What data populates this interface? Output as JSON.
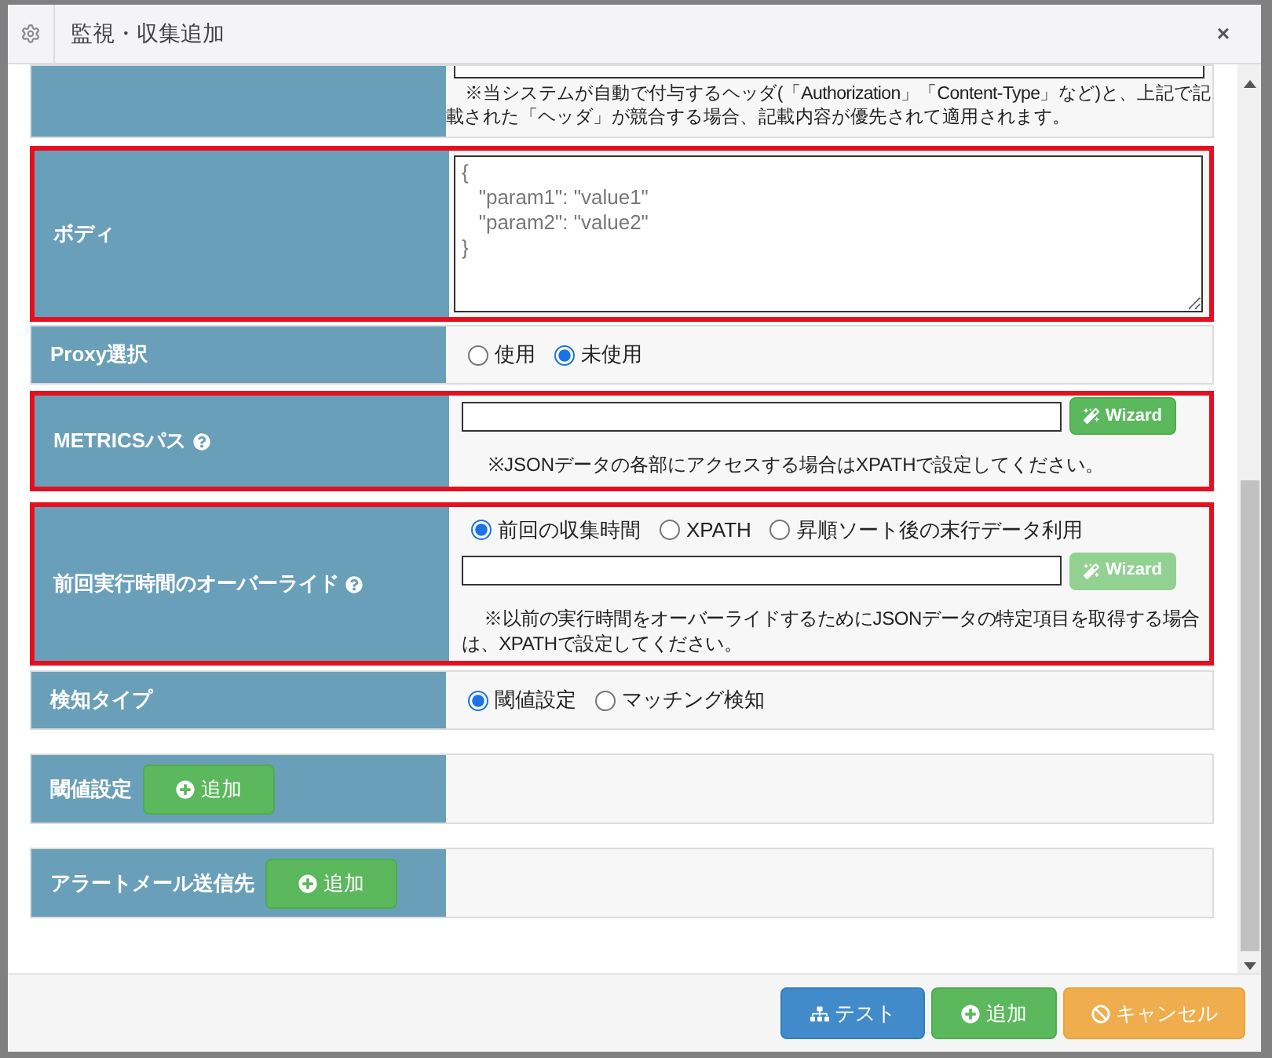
{
  "window": {
    "title": "監視・収集追加",
    "close": "×"
  },
  "rows": [
    {
      "kind": "note_tail",
      "highlighted": false,
      "note": "※当システムが自動で付与するヘッダ(「Authorization」「Content-Type」など)と、上記で記載された「ヘッダ」が競合する場合、記載内容が優先されて適用されます。"
    },
    {
      "kind": "textarea",
      "label": "ボディ",
      "highlighted": true,
      "placeholder": "{\n   \"param1\": \"value1\"\n   \"param2\": \"value2\"\n}"
    },
    {
      "kind": "radio",
      "label": "Proxy選択",
      "highlighted": false,
      "options": [
        {
          "label": "使用",
          "selected": false
        },
        {
          "label": "未使用",
          "selected": true
        }
      ]
    },
    {
      "kind": "path",
      "label": "METRICSパス",
      "help": true,
      "highlighted": true,
      "button": {
        "label": "Wizard",
        "disabled": false
      },
      "note": "※JSONデータの各部にアクセスする場合はXPATHで設定してください。"
    },
    {
      "kind": "override",
      "label": "前回実行時間のオーバーライド",
      "help": true,
      "highlighted": true,
      "options": [
        {
          "label": "前回の収集時間",
          "selected": true
        },
        {
          "label": "XPATH",
          "selected": false
        },
        {
          "label": "昇順ソート後の末行データ利用",
          "selected": false
        }
      ],
      "button": {
        "label": "Wizard",
        "disabled": true
      },
      "note": "※以前の実行時間をオーバーライドするためにJSONデータの特定項目を取得する場合は、XPATHで設定してください。"
    },
    {
      "kind": "radio",
      "label": "検知タイプ",
      "highlighted": false,
      "options": [
        {
          "label": "閾値設定",
          "selected": true
        },
        {
          "label": "マッチング検知",
          "selected": false
        }
      ]
    },
    {
      "kind": "add",
      "label": "閾値設定",
      "highlighted": false,
      "button": "追加"
    },
    {
      "kind": "add",
      "label": "アラートメール送信先",
      "highlighted": false,
      "button": "追加"
    }
  ],
  "footer": [
    {
      "kind": "test",
      "label": "テスト"
    },
    {
      "kind": "add",
      "label": "追加"
    },
    {
      "kind": "cancel",
      "label": "キャンセル"
    }
  ]
}
